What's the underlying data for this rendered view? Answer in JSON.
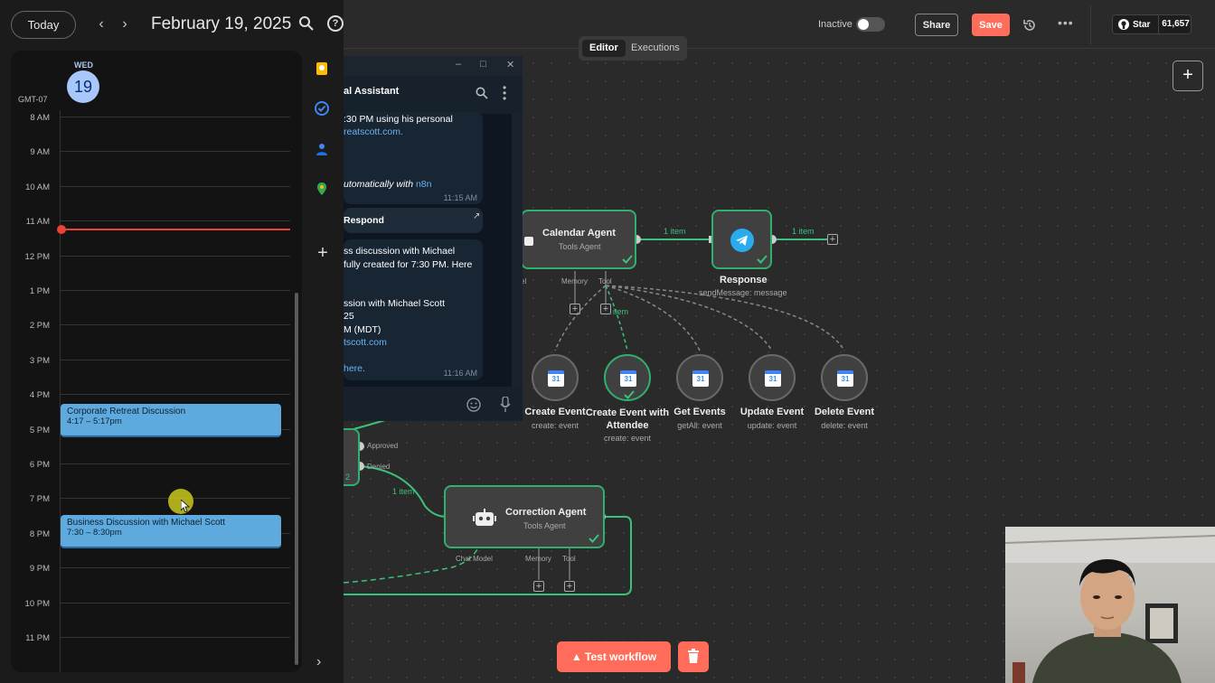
{
  "calendar": {
    "today_label": "Today",
    "prev_icon": "chevron-left-icon",
    "next_icon": "chevron-right-icon",
    "date_title": "February 19, 2025",
    "day_abbr": "WED",
    "day_number": "19",
    "timezone": "GMT-07",
    "hours": [
      "8 AM",
      "9 AM",
      "10 AM",
      "11 AM",
      "12 PM",
      "1 PM",
      "2 PM",
      "3 PM",
      "4 PM",
      "5 PM",
      "6 PM",
      "7 PM",
      "8 PM",
      "9 PM",
      "10 PM",
      "11 PM"
    ],
    "events": [
      {
        "title": "Corporate Retreat Discussion",
        "time": "4:17 – 5:17pm"
      },
      {
        "title": "Business Discussion with Michael Scott",
        "time": "7:30 – 8:30pm"
      }
    ],
    "now_color": "#ea4335",
    "event_color": "#5ea9dd"
  },
  "topbar": {
    "status_label": "Inactive",
    "share_label": "Share",
    "save_label": "Save",
    "star_label": "Star",
    "star_count": "61,657",
    "accent": "#ff6d5a"
  },
  "tabs": [
    {
      "label": "Editor",
      "active": true
    },
    {
      "label": "Executions",
      "active": false
    }
  ],
  "chat": {
    "title": "al Assistant",
    "messages": [
      {
        "lines": [
          ":30 PM using his personal",
          "reatscott.com."
        ],
        "italic": "utomatically with",
        "italic_link": "n8n",
        "time": "11:15 AM"
      },
      {
        "reply_title": "Respond"
      },
      {
        "lines": [
          "ss discussion with Michael",
          "fully created for 7:30 PM. Here",
          "",
          "ssion with Michael Scott",
          "25",
          "M (MDT)",
          "tscott.com",
          "",
          "here."
        ],
        "time": "11:16 AM"
      }
    ]
  },
  "workflow": {
    "calendar_agent": {
      "title": "Calendar Agent",
      "subtitle": "Tools Agent",
      "memory": "Memory",
      "tool": "Tool",
      "model_fragment": "el"
    },
    "response_node": {
      "title": "Response",
      "subtitle": "sendMessage: message"
    },
    "edge_items": [
      "1 item",
      "1 item",
      "item",
      "1 item"
    ],
    "tools": [
      {
        "title": "Create Event",
        "subtitle": "create: event",
        "checked": false
      },
      {
        "title": "Create Event with Attendee",
        "subtitle": "create: event",
        "checked": true
      },
      {
        "title": "Get Events",
        "subtitle": "getAll: event",
        "checked": false
      },
      {
        "title": "Update Event",
        "subtitle": "update: event",
        "checked": false
      },
      {
        "title": "Delete Event",
        "subtitle": "delete: event",
        "checked": false
      }
    ],
    "branch_labels": [
      "Approved",
      "Denied"
    ],
    "branch_fragment": "2",
    "correction_agent": {
      "title": "Correction Agent",
      "subtitle": "Tools Agent",
      "chat_model": "Chat Model",
      "memory": "Memory",
      "tool": "Tool"
    },
    "test_label": "Test workflow",
    "node_border": "#30b06d"
  }
}
